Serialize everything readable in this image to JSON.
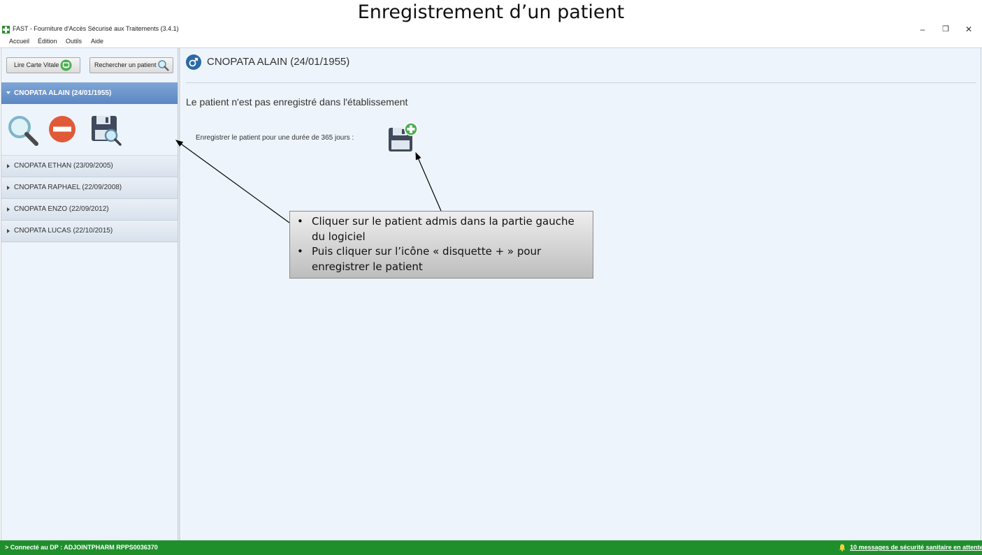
{
  "slide": {
    "title": "Enregistrement d’un patient"
  },
  "window": {
    "title": "FAST - Fourniture d'Accès Sécurisé aux Traitements (3.4.1)",
    "minimize": "–",
    "restore": "❐",
    "close": "✕"
  },
  "menu": {
    "items": [
      "Accueil",
      "Édition",
      "Outils",
      "Aide"
    ]
  },
  "sidebar": {
    "read_card_label": "Lire Carte Vitale",
    "search_patient_label": "Rechercher un patient",
    "selected_patient": "CNOPATA ALAIN (24/01/1955)",
    "patients": [
      "CNOPATA ETHAN (23/09/2005)",
      "CNOPATA RAPHAEL (22/09/2008)",
      "CNOPATA ENZO (22/09/2012)",
      "CNOPATA LUCAS (22/10/2015)"
    ]
  },
  "main": {
    "patient_title": "CNOPATA ALAIN (24/01/1955)",
    "status": "Le patient n'est pas enregistré dans l'établissement",
    "register_label": "Enregistrer le patient pour une durée de 365 jours :"
  },
  "callout": {
    "lines": [
      "Cliquer sur le patient admis dans la partie gauche du logiciel",
      "Puis cliquer sur l’icône « disquette + » pour enregistrer le patient"
    ]
  },
  "statusbar": {
    "left": "> Connecté au DP : ADJOINTPHARM RPPS0036370",
    "right": "10 messages de sécurité sanitaire en attente"
  },
  "colors": {
    "selected_row": "#6a94cc",
    "statusbar": "#1f8f2c",
    "panel_bg": "#eef4fb",
    "accent_blue": "#2b6aa5"
  }
}
